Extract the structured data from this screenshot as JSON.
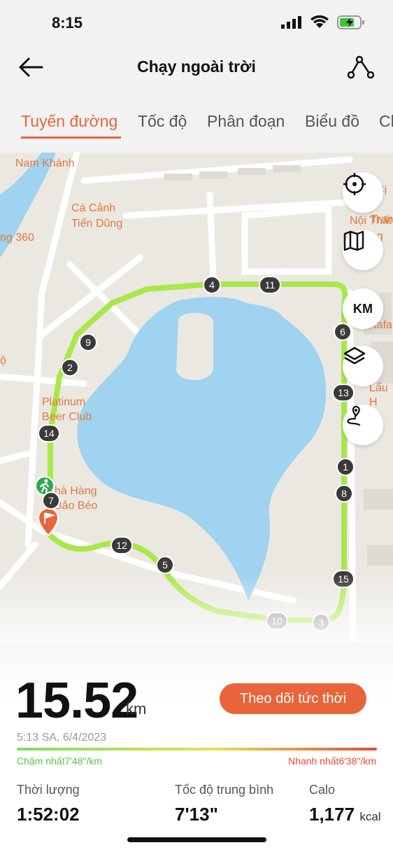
{
  "status": {
    "time": "8:15"
  },
  "header": {
    "title": "Chạy ngoài trời"
  },
  "tabs": [
    {
      "label": "Tuyến đường",
      "active": true
    },
    {
      "label": "Tốc độ"
    },
    {
      "label": "Phân đoạn"
    },
    {
      "label": "Biểu đồ"
    },
    {
      "label": "Ch"
    }
  ],
  "map": {
    "labels": {
      "nam_khanh": "Nam Khánh",
      "ca_canh_1": "Cá Cảnh",
      "ca_canh_2": "Tiến Dũng",
      "g360": "ng 360",
      "platinum_1": "Platinum",
      "platinum_2": "Beer Club",
      "nha_hang_1": "hà Hàng",
      "nha_hang_2": "Bảo Béo",
      "right_1": "t Bị",
      "right_2": "i Tran",
      "right_3": "Nội Thất",
      "right_4": "ng",
      "kafa": "Kafa",
      "lau": "Lẩu H",
      "o": "ộ"
    },
    "controls": {
      "unit": "KM"
    },
    "km_markers": [
      {
        "n": "1"
      },
      {
        "n": "2"
      },
      {
        "n": "3"
      },
      {
        "n": "4"
      },
      {
        "n": "5"
      },
      {
        "n": "6"
      },
      {
        "n": "7"
      },
      {
        "n": "8"
      },
      {
        "n": "9"
      },
      {
        "n": "10"
      },
      {
        "n": "11"
      },
      {
        "n": "12"
      },
      {
        "n": "13"
      },
      {
        "n": "14"
      },
      {
        "n": "15"
      }
    ],
    "colors": {
      "route": "#a8e84a",
      "lake": "#9fd3ef",
      "accent": "#e8643a"
    }
  },
  "summary": {
    "distance": "15.52",
    "distance_unit": "km",
    "live_button": "Theo dõi tức thời",
    "datetime": "5:13 SA, 6/4/2023",
    "slowest": "Chậm nhất7'48\"/km",
    "fastest": "Nhanh nhất6'38\"/km",
    "duration_label": "Thời lượng",
    "duration_value": "1:52:02",
    "avg_pace_label": "Tốc độ trung bình",
    "avg_pace_value": "7'13\"",
    "calories_label": "Calo",
    "calories_value": "1,177",
    "calories_unit": "kcal"
  }
}
